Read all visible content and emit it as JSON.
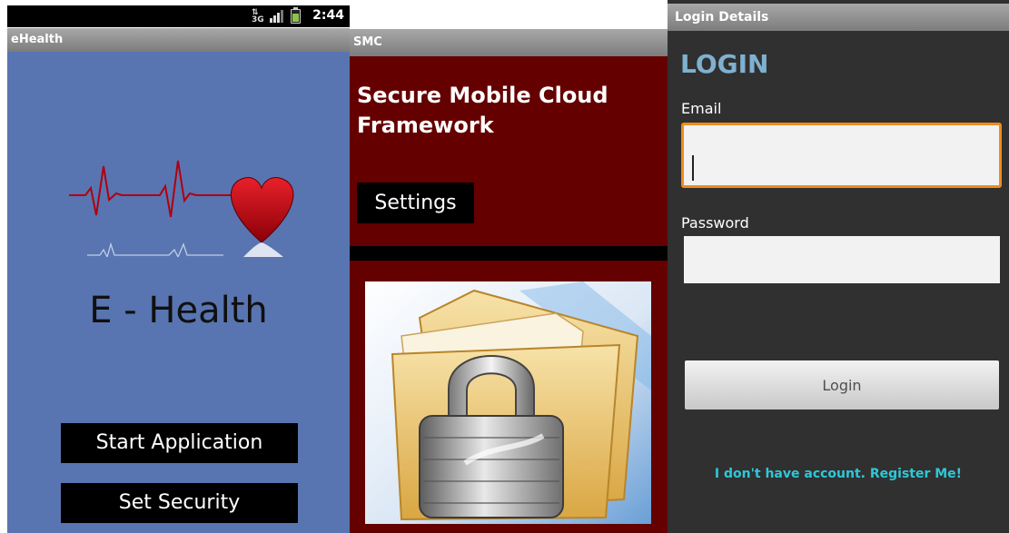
{
  "colors": {
    "ehealth_bg": "#5875b1",
    "smc_bg": "#640000",
    "login_bg": "#303030",
    "login_heading": "#7fb0cf",
    "email_focus_border": "#f08c1a",
    "register_link": "#2ec8d8",
    "titlebar": "#8f8f8f"
  },
  "screen1": {
    "status_bar": {
      "network_icon": "3g-network-icon",
      "signal_icon": "signal-icon",
      "battery_icon": "battery-charging-icon",
      "time": "2:44"
    },
    "title": "eHealth",
    "logo_icon": "heartbeat-heart-icon",
    "app_name": "E - Health",
    "start_button": "Start Application",
    "security_button": "Set Security"
  },
  "screen2": {
    "title": "SMC",
    "headline": "Secure Mobile Cloud Framework",
    "settings_button": "Settings",
    "image_icon": "locked-folder-icon"
  },
  "screen3": {
    "title": "Login Details",
    "heading": "LOGIN",
    "email_label": "Email",
    "email_value": "",
    "password_label": "Password",
    "password_value": "",
    "login_button": "Login",
    "register_link": "I don't have account. Register Me!"
  }
}
